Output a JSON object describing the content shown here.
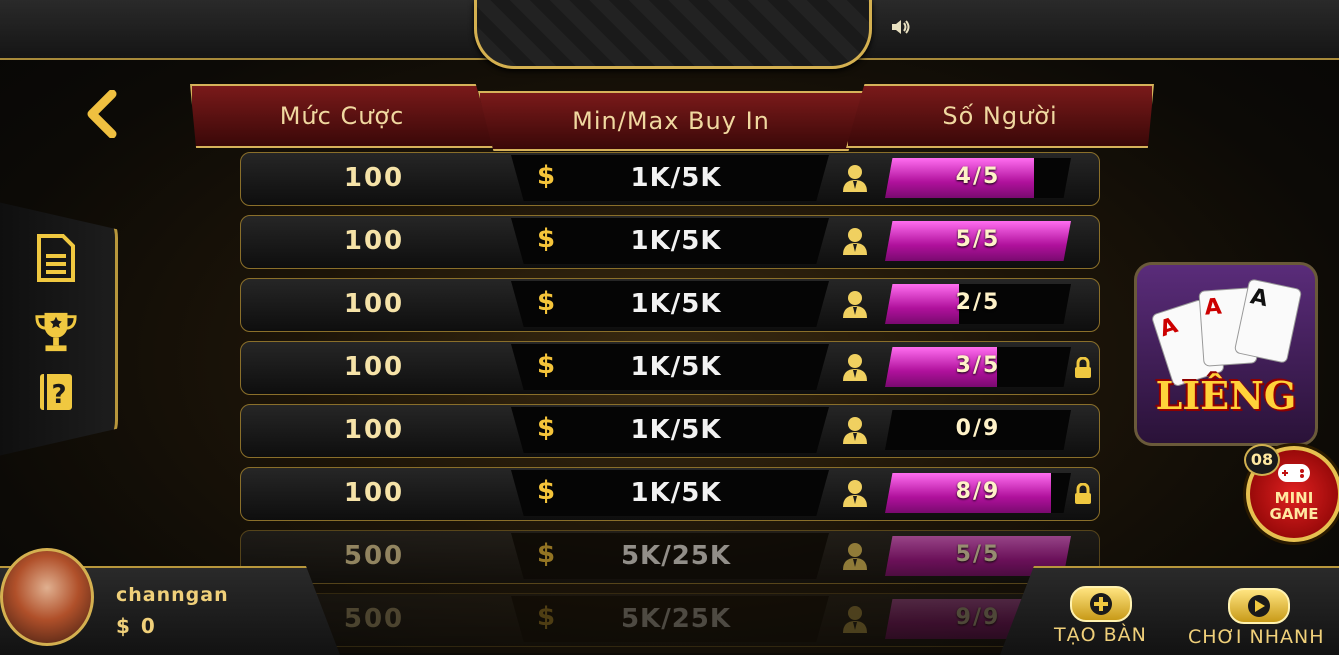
{
  "header": {
    "col_bet": "Mức Cược",
    "col_buyin": "Min/Max Buy In",
    "col_players": "Số Người"
  },
  "rows": [
    {
      "bet": "100",
      "buyin": "1K/5K",
      "players": "4/5",
      "fill": 0.8,
      "locked": false
    },
    {
      "bet": "100",
      "buyin": "1K/5K",
      "players": "5/5",
      "fill": 1.0,
      "locked": false
    },
    {
      "bet": "100",
      "buyin": "1K/5K",
      "players": "2/5",
      "fill": 0.4,
      "locked": false
    },
    {
      "bet": "100",
      "buyin": "1K/5K",
      "players": "3/5",
      "fill": 0.6,
      "locked": true
    },
    {
      "bet": "100",
      "buyin": "1K/5K",
      "players": "0/9",
      "fill": 0.0,
      "locked": false
    },
    {
      "bet": "100",
      "buyin": "1K/5K",
      "players": "8/9",
      "fill": 0.89,
      "locked": true
    },
    {
      "bet": "500",
      "buyin": "5K/25K",
      "players": "5/5",
      "fill": 1.0,
      "locked": false
    },
    {
      "bet": "500",
      "buyin": "5K/25K",
      "players": "9/9",
      "fill": 1.0,
      "locked": false
    }
  ],
  "currency_symbol": "$",
  "game_banner": {
    "title": "LIÊNG",
    "card_rank": "A"
  },
  "mini_game": {
    "badge": "08",
    "label_line1": "MINI",
    "label_line2": "GAME"
  },
  "user": {
    "name": "channgan",
    "balance": "$ 0"
  },
  "actions": {
    "create_table": "TẠO BÀN",
    "quick_play": "CHƠI NHANH"
  },
  "icons": {
    "back": "chevron-left-icon",
    "sound": "speaker-icon",
    "history": "document-icon",
    "leaderboard": "trophy-icon",
    "help": "help-book-icon",
    "player": "person-icon",
    "lock": "lock-icon"
  },
  "colors": {
    "gold": "#d4b050",
    "header_red": "#7a1a1a",
    "bar_magenta": "#d420c0"
  }
}
